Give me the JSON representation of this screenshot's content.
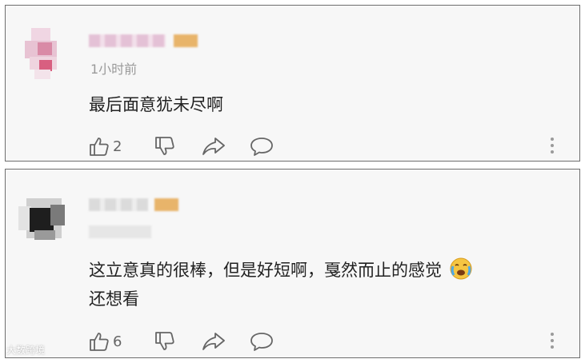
{
  "comments": [
    {
      "time": "1小时前",
      "text": "最后面意犹未尽啊",
      "like_icon": "thumbs-up-icon",
      "likes": "2",
      "dislike_icon": "thumbs-down-icon",
      "share_icon": "share-icon",
      "reply_icon": "comment-icon",
      "more_icon": "more-vertical-icon"
    },
    {
      "time": "",
      "text_line1": "这立意真的很棒，但是好短啊，戛然而止的感觉",
      "emoji": "crying-face-emoji",
      "text_line2": "还想看",
      "like_icon": "thumbs-up-icon",
      "likes": "6",
      "dislike_icon": "thumbs-down-icon",
      "share_icon": "share-icon",
      "reply_icon": "comment-icon",
      "more_icon": "more-vertical-icon"
    }
  ],
  "watermark": "大数跨境",
  "colors": {
    "card_bg": "#f7f7f7",
    "border": "#6e6e6e",
    "text": "#222222",
    "muted": "#9a9a9a",
    "badge": "#e8b46a"
  }
}
